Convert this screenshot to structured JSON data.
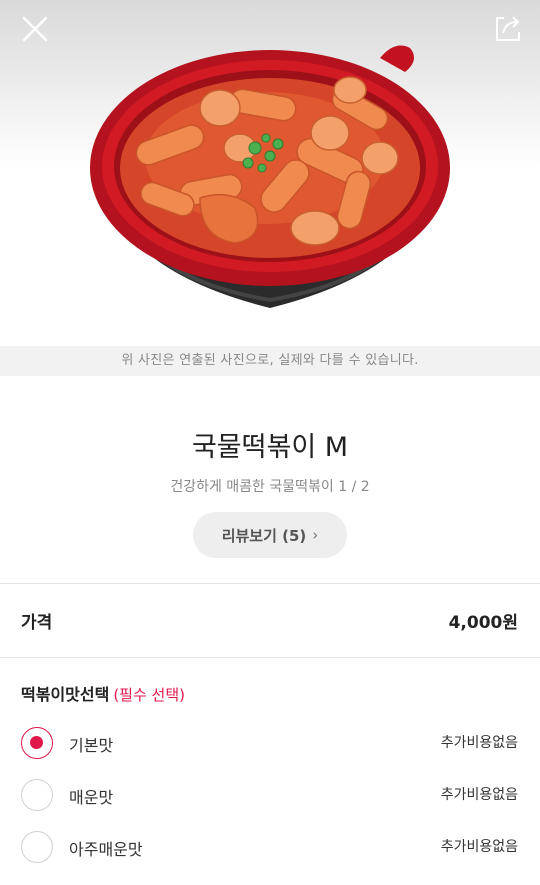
{
  "header": {
    "close_icon": "close-icon",
    "share_icon": "share-icon"
  },
  "photo_notice": "위 사진은 연출된 사진으로, 실제와 다를 수 있습니다.",
  "product": {
    "name": "국물떡볶이 M",
    "description": "건강하게 매콤한 국물떡볶이 1 / 2",
    "review_button": "리뷰보기 (5)"
  },
  "price": {
    "label": "가격",
    "value": "4,000원"
  },
  "option_group": {
    "title": "떡볶이맛선택",
    "required": "(필수 선택)",
    "options": [
      {
        "label": "기본맛",
        "extra": "추가비용없음",
        "selected": true
      },
      {
        "label": "매운맛",
        "extra": "추가비용없음",
        "selected": false
      },
      {
        "label": "아주매운맛",
        "extra": "추가비용없음",
        "selected": false
      }
    ]
  },
  "colors": {
    "accent": "#e0184a",
    "broth": "#d4452a",
    "bowl_rim": "#b3121e"
  }
}
